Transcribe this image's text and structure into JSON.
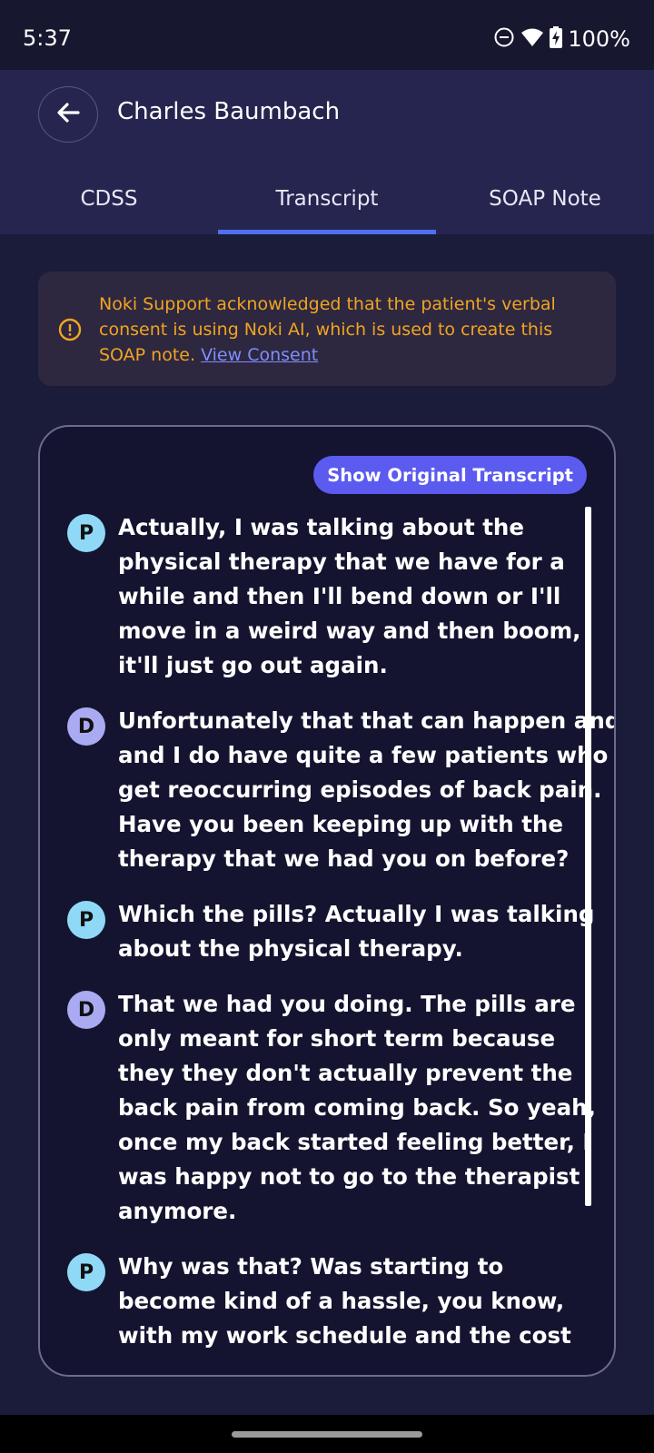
{
  "status_bar": {
    "time": "5:37",
    "battery_text": "100%",
    "icons": [
      "do-not-disturb-icon",
      "wifi-icon",
      "battery-charging-icon"
    ]
  },
  "header": {
    "patient_name": "Charles Baumbach",
    "tabs": [
      {
        "label": "CDSS",
        "active": false
      },
      {
        "label": "Transcript",
        "active": true
      },
      {
        "label": "SOAP Note",
        "active": false
      }
    ]
  },
  "consent": {
    "lines": [
      "Noki Support acknowledged that the patient's verbal",
      "consent is using Noki AI, which is used to create this"
    ],
    "last_line": "SOAP note.",
    "link_text": "View Consent"
  },
  "transcript": {
    "show_original_label": "Show Original Transcript",
    "messages": [
      {
        "speaker": "P",
        "lines": [
          "Actually, I was talking about the",
          "physical therapy that we have for a",
          "while and then I'll bend down or I'll",
          "move in a weird way and then boom,",
          "it'll just go out again."
        ]
      },
      {
        "speaker": "D",
        "lines": [
          "Unfortunately that that can happen and",
          "and I do have quite a few patients who",
          "get reoccurring episodes of back pain.",
          "Have you been keeping up with the",
          "therapy that we had you on before?"
        ]
      },
      {
        "speaker": "P",
        "lines": [
          "Which the pills? Actually I was talking",
          "about the physical therapy."
        ]
      },
      {
        "speaker": "D",
        "lines": [
          "That we had you doing. The pills are",
          "only meant for short term because",
          "they they don't actually prevent the",
          "back pain from coming back. So yeah,",
          "once my back started feeling better, I",
          "was happy not to go to the therapist",
          "anymore."
        ]
      },
      {
        "speaker": "P",
        "lines": [
          "Why was that? Was starting to",
          "become kind of a hassle, you know,",
          "with my work schedule and the cost"
        ]
      }
    ]
  },
  "colors": {
    "accent": "#4f6ff0",
    "button": "#5b5bef",
    "warning": "#f1a421",
    "avatar_patient": "#8fd9f6",
    "avatar_doctor": "#aaaaf3"
  }
}
